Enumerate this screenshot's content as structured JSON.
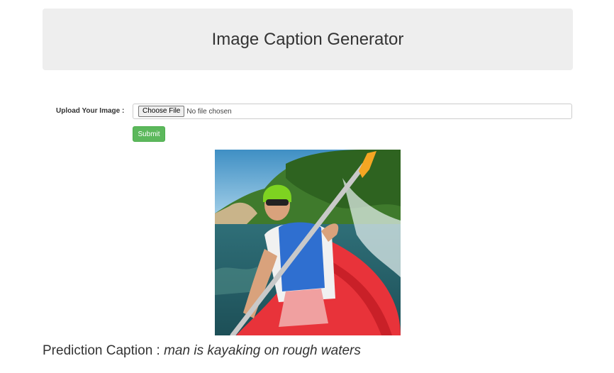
{
  "header": {
    "title": "Image Caption Generator"
  },
  "form": {
    "upload_label": "Upload Your Image :",
    "choose_file_label": "Choose File",
    "no_file_text": "No file chosen",
    "submit_label": "Submit"
  },
  "result": {
    "caption_prefix": "Prediction Caption :",
    "caption_text": "man is kayaking on rough waters"
  },
  "colors": {
    "header_bg": "#eeeeee",
    "submit_bg": "#5cb85c",
    "kayak_red": "#e8333a",
    "helmet_green": "#7ed321",
    "paddle_yellow": "#f5a623"
  }
}
